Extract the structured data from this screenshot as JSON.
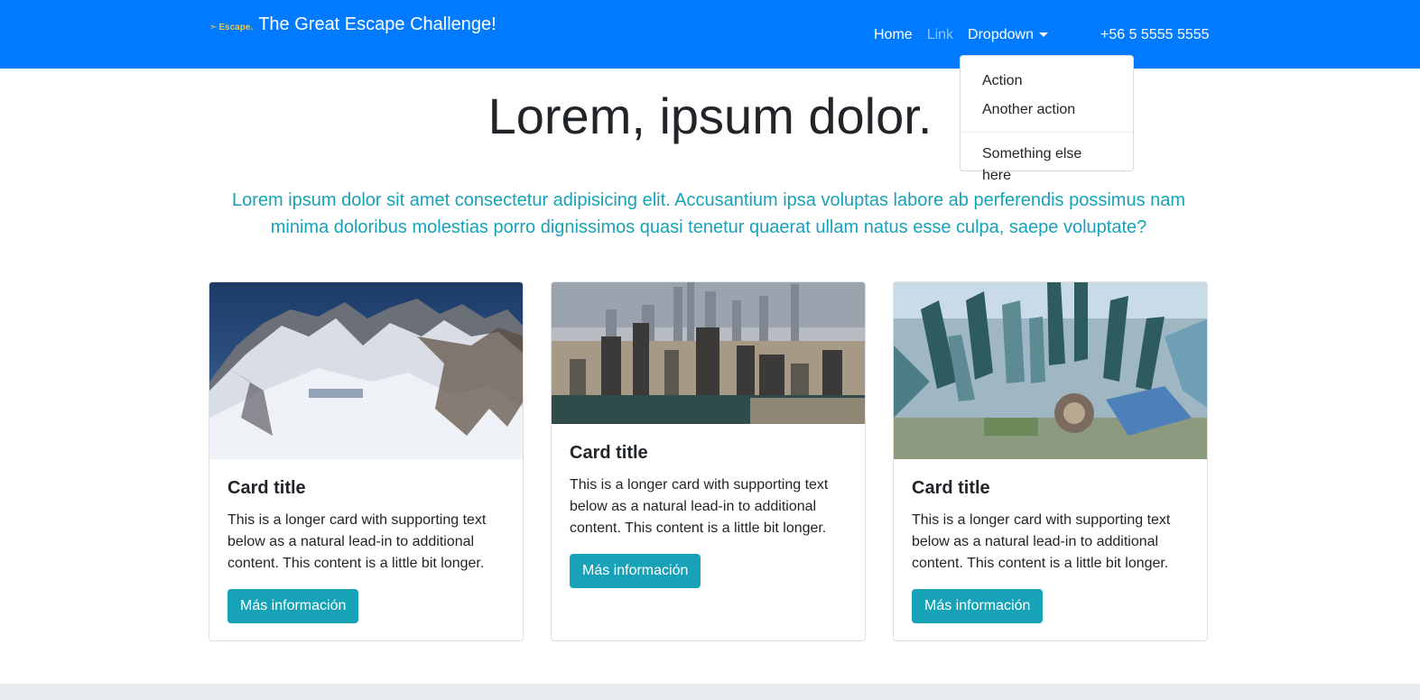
{
  "navbar": {
    "brand_logo_text": "Escape.",
    "brand_title": "The Great Escape Challenge!",
    "links": [
      {
        "label": "Home"
      },
      {
        "label": "Link"
      },
      {
        "label": "Dropdown"
      }
    ],
    "phone": "+56 5 5555 5555",
    "colors": {
      "background": "#007bff"
    }
  },
  "dropdown": {
    "items": [
      {
        "label": "Action"
      },
      {
        "label": "Another action"
      },
      {
        "label": "Something else here"
      }
    ]
  },
  "hero": {
    "title": "Lorem, ipsum dolor.",
    "lead": "Lorem ipsum dolor sit amet consectetur adipisicing elit. Accusantium ipsa voluptas labore ab perferendis possimus nam minima doloribus molestias porro dignissimos quasi tenetur quaerat ullam natus esse culpa, saepe voluptate?",
    "lead_color": "#17a2b8"
  },
  "cards": [
    {
      "image": "mountain-landscape",
      "title": "Card title",
      "text": "This is a longer card with supporting text below as a natural lead-in to additional content. This content is a little bit longer.",
      "button": "Más información"
    },
    {
      "image": "city-skyline",
      "title": "Card title",
      "text": "This is a longer card with supporting text below as a natural lead-in to additional content. This content is a little bit longer.",
      "button": "Más información"
    },
    {
      "image": "aerial-city",
      "title": "Card title",
      "text": "This is a longer card with supporting text below as a natural lead-in to additional content. This content is a little bit longer.",
      "button": "Más información"
    }
  ],
  "colors": {
    "button": "#17a2b8"
  }
}
